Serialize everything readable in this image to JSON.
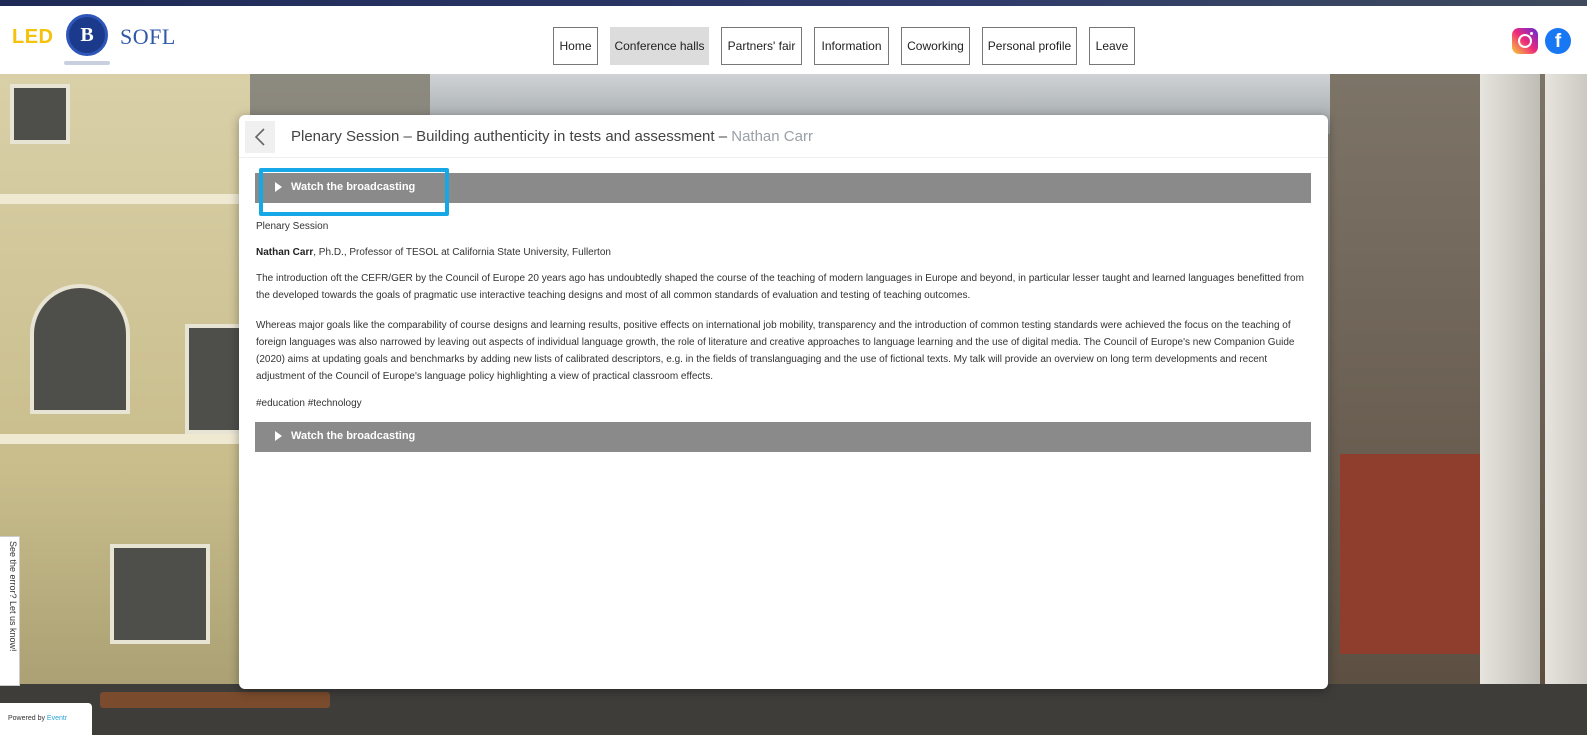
{
  "header": {
    "logo_led": "LED",
    "logo_hse": "B",
    "logo_sofl": "SOFL"
  },
  "nav": {
    "items": [
      {
        "label": "Home",
        "active": false
      },
      {
        "label": "Conference halls",
        "active": true
      },
      {
        "label": "Partners' fair",
        "active": false
      },
      {
        "label": "Information",
        "active": false
      },
      {
        "label": "Coworking",
        "active": false
      },
      {
        "label": "Personal profile",
        "active": false
      },
      {
        "label": "Leave",
        "active": false
      }
    ]
  },
  "social": {
    "instagram_icon": "instagram-icon",
    "facebook_icon": "facebook-icon",
    "facebook_glyph": "f"
  },
  "modal": {
    "title": "Plenary Session – Building authenticity in tests and assessment – ",
    "title_speaker": "Nathan Carr",
    "back_icon": "chevron-left-icon",
    "accordion_top_label": "Watch the broadcasting",
    "session_type": "Plenary Session",
    "speaker_name": "Nathan Carr",
    "speaker_details": ", Ph.D., Professor of TESOL at California State University, Fullerton",
    "paragraph1": "The introduction oft the CEFR/GER by the Council of Europe 20 years ago has undoubtedly shaped the course of the teaching of modern languages in Europe and beyond, in particular lesser taught and learned languages benefitted from the developed towards the goals of pragmatic use interactive teaching designs and most of all common standards of evaluation and testing of teaching outcomes.",
    "paragraph2": "Whereas major goals like the comparability of course designs and learning results, positive effects on international job mobility, transparency and the introduction of common testing standards were achieved the focus on the teaching of foreign languages was also narrowed by leaving out aspects of individual language growth, the role of literature and creative approaches to language learning and the use of digital media. The Council of Europe's new Companion Guide (2020) aims at updating goals and benchmarks by adding new lists of calibrated descriptors, e.g. in the fields of translanguaging and the use of fictional texts. My talk will provide an overview on long term developments and recent adjustment of the Council of Europe's language policy highlighting a view of practical classroom effects.",
    "tags": "#education #technology",
    "accordion_bottom_label": "Watch the broadcasting"
  },
  "feedback": {
    "tab_label": "See the error? Let us know!",
    "powered_prefix": "Powered by ",
    "powered_brand": "Eventr"
  },
  "colors": {
    "accent_focus": "#16a8e6",
    "accordion_bg": "#8a8a8a",
    "nav_active_bg": "#dcdcdc",
    "sofl_blue": "#2f59a8",
    "led_yellow": "#f4c20d"
  }
}
